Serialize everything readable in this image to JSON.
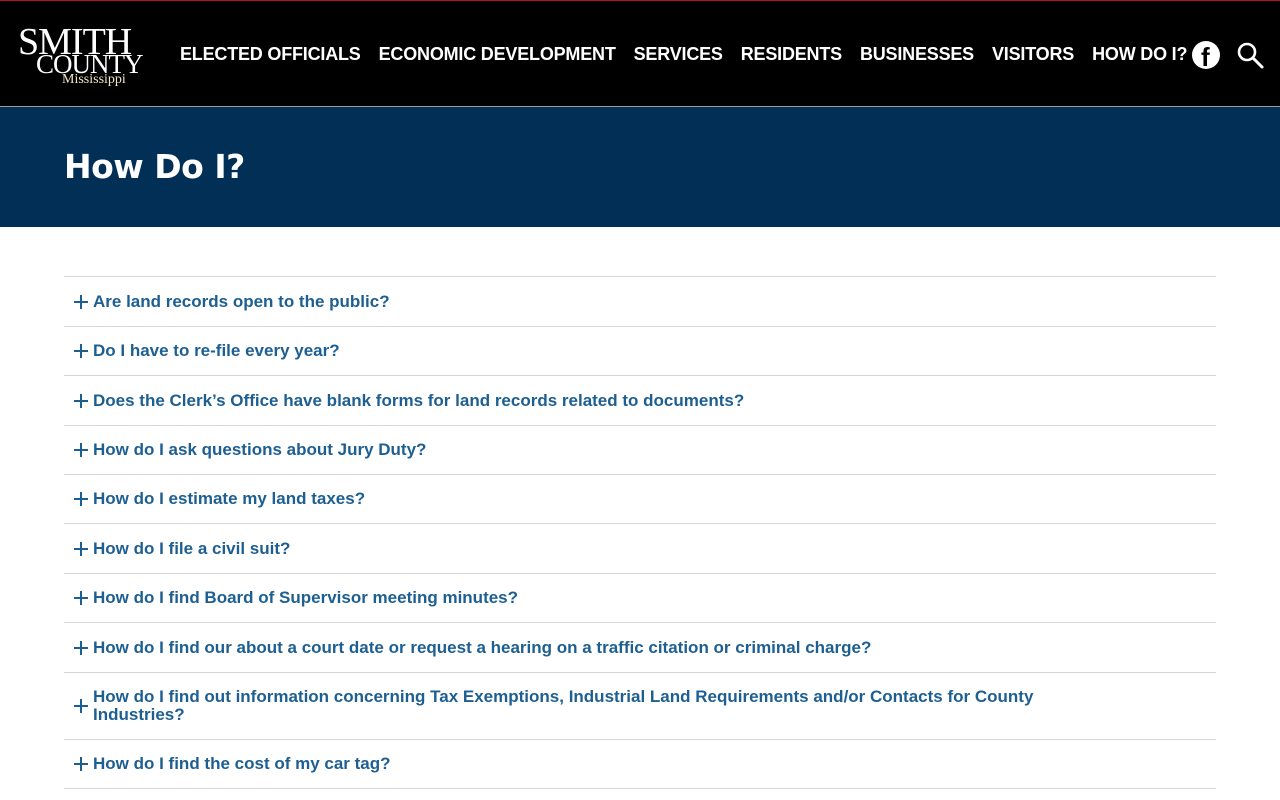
{
  "header": {
    "logo": {
      "line1": "SMITH",
      "line2": "COUNTY",
      "line3": "Mississippi"
    },
    "nav": [
      "ELECTED OFFICIALS",
      "ECONOMIC DEVELOPMENT",
      "SERVICES",
      "RESIDENTS",
      "BUSINESSES",
      "VISITORS",
      "HOW DO I?"
    ],
    "icons": {
      "facebook": "facebook-icon",
      "search": "search-icon"
    }
  },
  "hero": {
    "title": "How Do I?"
  },
  "faq": {
    "items": [
      "Are land records open to the public?",
      "Do I have to re-file every year?",
      "Does the Clerk’s Office have blank forms for land records related to documents?",
      "How do I ask questions about Jury Duty?",
      "How do I estimate my land taxes?",
      "How do I file a civil suit?",
      "How do I find Board of Supervisor meeting minutes?",
      "How do I find our about a court date or request a hearing on a traffic citation or criminal charge?",
      "How do I find out information concerning Tax Exemptions, Industrial Land Requirements and/or Contacts for County Industries?",
      "How do I find the cost of my car tag?"
    ]
  },
  "colors": {
    "header_bg": "#000000",
    "hero_bg": "#022f55",
    "link": "#1e5f92",
    "accent_top": "#b3121f"
  }
}
